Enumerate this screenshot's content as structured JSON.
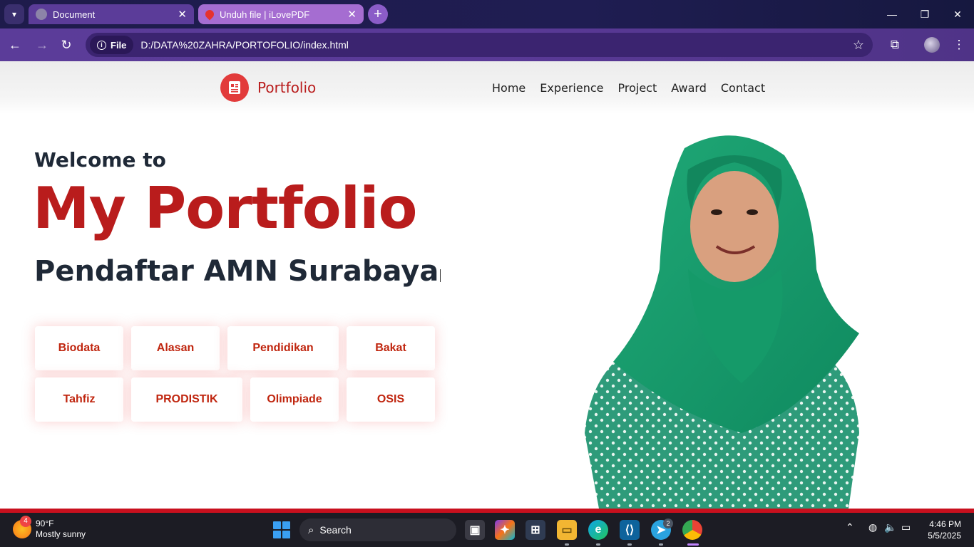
{
  "browser": {
    "tabs": [
      {
        "title": "Document",
        "active": true
      },
      {
        "title": "Unduh file | iLovePDF",
        "active": false
      }
    ],
    "url_chip": "File",
    "url": "D:/DATA%20ZAHRA/PORTOFOLIO/index.html"
  },
  "site": {
    "brand": "Portfolio",
    "nav": [
      "Home",
      "Experience",
      "Project",
      "Award",
      "Contact"
    ],
    "welcome": "Welcome to",
    "title": "My Portfolio",
    "subtitle": "Pendaftar AMN Surabaya",
    "buttons_row1": [
      "Biodata",
      "Alasan",
      "Pendidikan",
      "Bakat"
    ],
    "buttons_row2": [
      "Tahfiz",
      "PRODISTIK",
      "Olimpiade",
      "OSIS"
    ]
  },
  "colors": {
    "accent": "#b91c1c",
    "button_text": "#c0260f",
    "footer_bar": "#c8101e"
  },
  "taskbar": {
    "weather_temp": "90°F",
    "weather_desc": "Mostly sunny",
    "weather_badge": "4",
    "search_label": "Search",
    "telegram_badge": "2",
    "time": "4:46 PM",
    "date": "5/5/2025"
  }
}
